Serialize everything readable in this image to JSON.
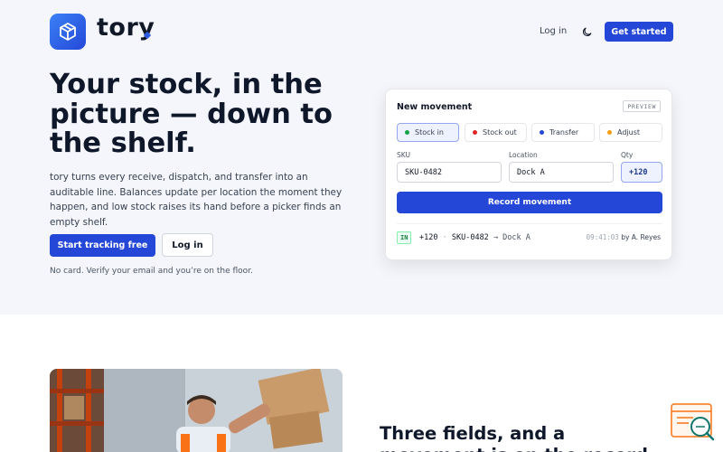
{
  "brand": {
    "name": "tory",
    "logo_icon": "cube-icon",
    "accent": "#2447d8"
  },
  "nav": {
    "login_label": "Log in",
    "theme_icon": "moon-icon",
    "cta_label": "Get started"
  },
  "hero": {
    "headline": "Your stock, in the picture — down to the shelf.",
    "subcopy": "tory turns every receive, dispatch, and transfer into an auditable line. Balances update per location the moment they happen, and low stock raises its hand before a picker finds an empty shelf.",
    "primary_cta": "Start tracking free",
    "secondary_cta": "Log in",
    "fineprint": "No card. Verify your email and you’re on the floor."
  },
  "movement_card": {
    "title": "New movement",
    "badge": "PREVIEW",
    "types": [
      {
        "label": "Stock in",
        "color": "#16a34a",
        "active": true
      },
      {
        "label": "Stock out",
        "color": "#dc2626",
        "active": false
      },
      {
        "label": "Transfer",
        "color": "#2447d8",
        "active": false
      },
      {
        "label": "Adjust",
        "color": "#f59e0b",
        "active": false
      }
    ],
    "fields": {
      "sku_label": "SKU",
      "sku_value": "SKU-0482",
      "location_label": "Location",
      "location_value": "Dock A",
      "qty_label": "Qty",
      "qty_value": "+120"
    },
    "submit_label": "Record movement",
    "log_entry": {
      "tag": "IN",
      "qty": "+120",
      "dot": "·",
      "sku": "SKU-0482",
      "arrow": "→ Dock A",
      "time": "09:41:03",
      "by": "by A. Reyes"
    }
  },
  "section": {
    "heading": "Three fields, and a movement is on the record"
  },
  "support": {
    "icon": "support-search-icon"
  }
}
